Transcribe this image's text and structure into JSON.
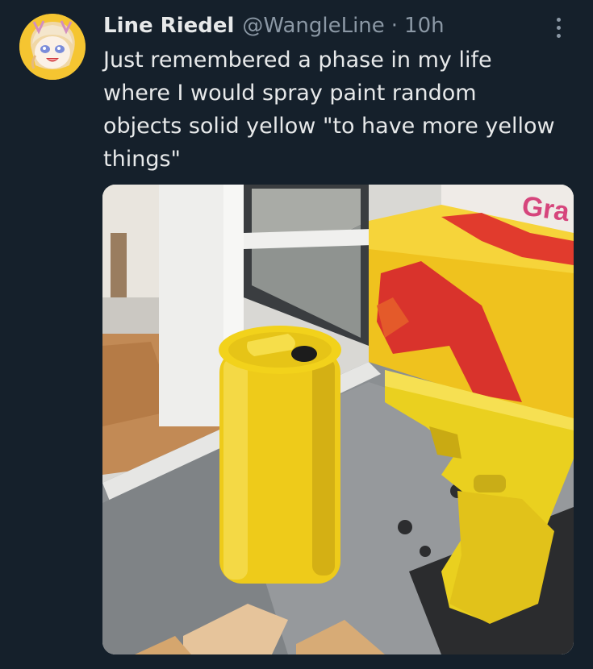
{
  "tweet": {
    "display_name": "Line Riedel",
    "handle": "@WangleLine",
    "separator": "·",
    "time": "10h",
    "text_lines": [
      "Just remembered a phase in my life",
      "where I would spray paint random",
      "objects solid yellow \"to have more yellow",
      "things\""
    ]
  },
  "photo": {
    "box_print": "Gra"
  },
  "icons": {
    "more": "more-options-icon",
    "avatar": "avatar"
  },
  "colors": {
    "background": "#15202b",
    "primary_text": "#e7e9ea",
    "secondary_text": "#8b98a5",
    "paint_yellow": "#f2d21b"
  }
}
